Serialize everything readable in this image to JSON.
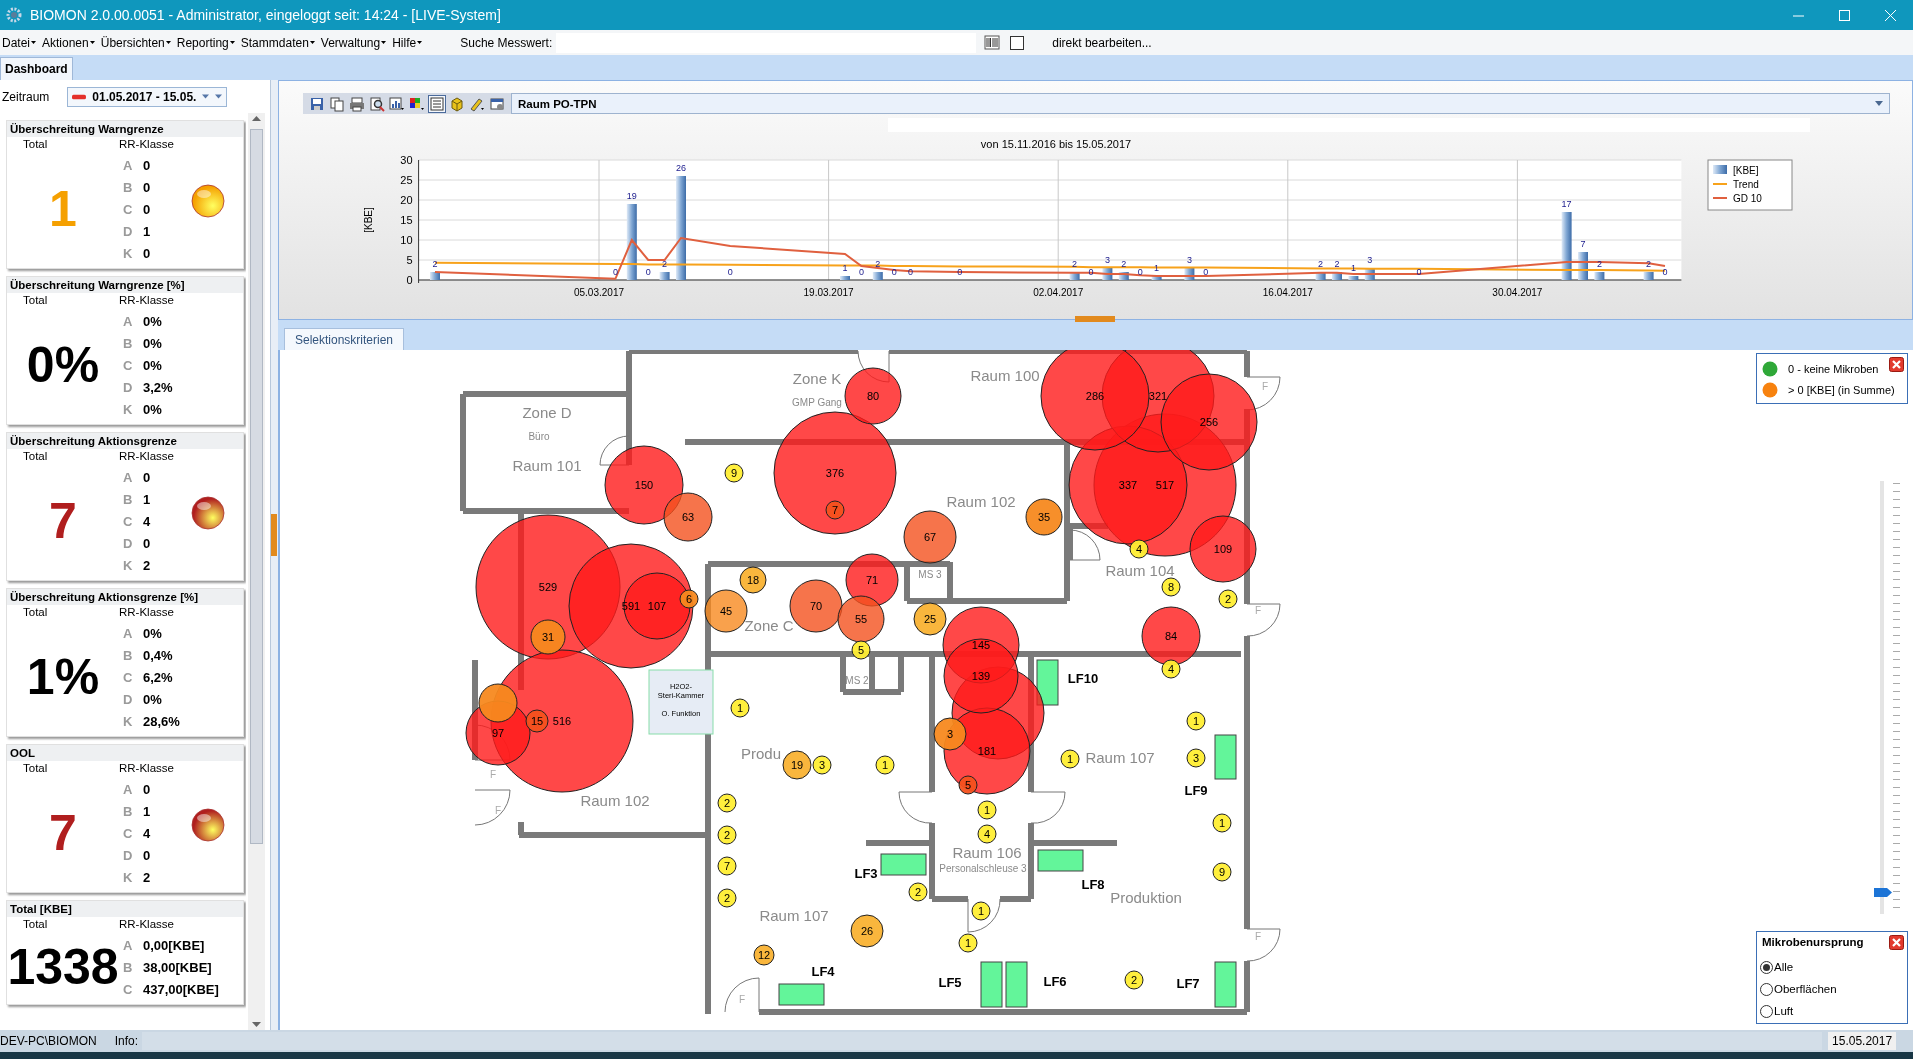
{
  "window": {
    "title": "BIOMON 2.0.00.0051 - Administrator, eingeloggt seit: 14:24 - [LIVE-System]"
  },
  "menu": [
    "Datei",
    "Aktionen",
    "Übersichten",
    "Reporting",
    "Stammdaten",
    "Verwaltung",
    "Hilfe"
  ],
  "search": {
    "label": "Suche Messwert:"
  },
  "direct_edit": {
    "label": "direkt bearbeiten...",
    "checked": false
  },
  "tabs": [
    {
      "label": "Dashboard",
      "selected": true
    }
  ],
  "period": {
    "label": "Zeitraum",
    "value": "01.05.2017 - 15.05."
  },
  "cards": [
    {
      "title": "Überschreitung Warngrenze",
      "total_label": "Total",
      "class_label": "RR-Klasse",
      "total": "1",
      "color": "#f5a000",
      "alert": true,
      "rows": [
        {
          "class": "A",
          "value": "0"
        },
        {
          "class": "B",
          "value": "0"
        },
        {
          "class": "C",
          "value": "0"
        },
        {
          "class": "D",
          "value": "1"
        },
        {
          "class": "K",
          "value": "0"
        }
      ]
    },
    {
      "title": "Überschreitung Warngrenze [%]",
      "total_label": "Total",
      "class_label": "RR-Klasse",
      "total": "0%",
      "color": "#000000",
      "alert": false,
      "rows": [
        {
          "class": "A",
          "value": "0%"
        },
        {
          "class": "B",
          "value": "0%"
        },
        {
          "class": "C",
          "value": "0%"
        },
        {
          "class": "D",
          "value": "3,2%"
        },
        {
          "class": "K",
          "value": "0%"
        }
      ]
    },
    {
      "title": "Überschreitung Aktionsgrenze",
      "total_label": "Total",
      "class_label": "RR-Klasse",
      "total": "7",
      "color": "#b01e1e",
      "alert": true,
      "rows": [
        {
          "class": "A",
          "value": "0"
        },
        {
          "class": "B",
          "value": "1"
        },
        {
          "class": "C",
          "value": "4"
        },
        {
          "class": "D",
          "value": "0"
        },
        {
          "class": "K",
          "value": "2"
        }
      ]
    },
    {
      "title": "Überschreitung Aktionsgrenze [%]",
      "total_label": "Total",
      "class_label": "RR-Klasse",
      "total": "1%",
      "color": "#000000",
      "alert": false,
      "rows": [
        {
          "class": "A",
          "value": "0%"
        },
        {
          "class": "B",
          "value": "0,4%"
        },
        {
          "class": "C",
          "value": "6,2%"
        },
        {
          "class": "D",
          "value": "0%"
        },
        {
          "class": "K",
          "value": "28,6%"
        }
      ]
    },
    {
      "title": "OOL",
      "total_label": "Total",
      "class_label": "RR-Klasse",
      "total": "7",
      "color": "#b01e1e",
      "alert": true,
      "rows": [
        {
          "class": "A",
          "value": "0"
        },
        {
          "class": "B",
          "value": "1"
        },
        {
          "class": "C",
          "value": "4"
        },
        {
          "class": "D",
          "value": "0"
        },
        {
          "class": "K",
          "value": "2"
        }
      ]
    },
    {
      "title": "Total [KBE]",
      "total_label": "Total",
      "class_label": "RR-Klasse",
      "total": "1338",
      "color": "#000000",
      "alert": false,
      "rows": [
        {
          "class": "A",
          "value": "0,00[KBE]"
        },
        {
          "class": "B",
          "value": "38,00[KBE]"
        },
        {
          "class": "C",
          "value": "437,00[KBE]"
        }
      ]
    }
  ],
  "chart_panel": {
    "room": "Raum PO-TPN",
    "chart_data": {
      "type": "bar",
      "title": "von 15.11.2016 bis 15.05.2017",
      "ylabel": "[KBE]",
      "value_labels": [
        null,
        "2",
        null,
        null,
        null,
        null,
        null,
        null,
        null,
        null,
        null,
        null,
        "0",
        "19",
        "0",
        "2",
        "26",
        null,
        null,
        "0",
        null,
        null,
        null,
        null,
        null,
        null,
        "1",
        "0",
        "2",
        "0",
        "0",
        null,
        null,
        "0",
        null,
        null,
        null,
        null,
        null,
        null,
        "2",
        "0",
        "3",
        "2",
        "0",
        "1",
        null,
        "3",
        "0",
        null,
        null,
        null,
        null,
        null,
        null,
        "2",
        "2",
        "1",
        "3",
        null,
        null,
        "0",
        null,
        null,
        null,
        null,
        null,
        null,
        null,
        null,
        "17",
        "7",
        "2",
        null,
        null,
        "2",
        "0",
        null
      ],
      "grid": true,
      "legend": "right",
      "categories": [
        null,
        null,
        null,
        null,
        null,
        null,
        null,
        null,
        null,
        null,
        null,
        "05.03.2017",
        null,
        null,
        null,
        null,
        null,
        null,
        null,
        null,
        null,
        null,
        null,
        null,
        null,
        "19.03.2017",
        null,
        null,
        null,
        null,
        null,
        null,
        null,
        null,
        null,
        null,
        null,
        null,
        null,
        "02.04.2017",
        null,
        null,
        null,
        null,
        null,
        null,
        null,
        null,
        null,
        null,
        null,
        null,
        null,
        "16.04.2017",
        null,
        null,
        null,
        null,
        null,
        null,
        null,
        null,
        null,
        null,
        null,
        null,
        null,
        "30.04.2017",
        null,
        null,
        null,
        null,
        null,
        null,
        null,
        null,
        null,
        null
      ],
      "ylim": [
        0,
        30
      ],
      "yticks": [
        0,
        5,
        10,
        15,
        20,
        25,
        30
      ],
      "series": [
        {
          "name": "[KBE]",
          "color": "#7fa6d3",
          "values": [
            null,
            2,
            null,
            null,
            null,
            null,
            null,
            null,
            null,
            null,
            null,
            null,
            0,
            19,
            0,
            2,
            26,
            null,
            null,
            0,
            null,
            null,
            null,
            null,
            null,
            null,
            1,
            0,
            2,
            0,
            0,
            null,
            null,
            0,
            null,
            null,
            null,
            null,
            null,
            null,
            2,
            0,
            3,
            2,
            0,
            1,
            null,
            3,
            0,
            null,
            null,
            null,
            null,
            null,
            null,
            2,
            2,
            1,
            3,
            null,
            null,
            0,
            null,
            null,
            null,
            null,
            null,
            null,
            null,
            null,
            17,
            7,
            2,
            null,
            null,
            2,
            0,
            null
          ]
        },
        {
          "name": "Trend",
          "type": "line",
          "color": "#f7a21b",
          "values": [
            null,
            4.3,
            null,
            null,
            null,
            null,
            null,
            null,
            null,
            null,
            null,
            null,
            4.0,
            4.0,
            3.9,
            3.9,
            3.9,
            null,
            null,
            3.8,
            null,
            null,
            null,
            null,
            null,
            null,
            3.6,
            3.6,
            3.6,
            3.5,
            3.5,
            null,
            null,
            3.4,
            null,
            null,
            null,
            null,
            null,
            null,
            3.3,
            3.2,
            3.2,
            3.2,
            3.2,
            3.1,
            null,
            3.1,
            3.1,
            null,
            null,
            null,
            null,
            null,
            null,
            2.9,
            2.9,
            2.9,
            2.8,
            null,
            null,
            2.8,
            null,
            null,
            null,
            null,
            null,
            null,
            null,
            null,
            2.5,
            2.5,
            2.5,
            null,
            null,
            2.4,
            2.3,
            null
          ]
        },
        {
          "name": "GD 10",
          "type": "line",
          "color": "#e0603f",
          "values": [
            null,
            2,
            null,
            null,
            null,
            null,
            null,
            null,
            null,
            null,
            null,
            null,
            0.3,
            10,
            5,
            5,
            10.5,
            null,
            null,
            8.5,
            null,
            null,
            null,
            null,
            null,
            null,
            6.5,
            3.5,
            3,
            2.5,
            2.2,
            null,
            null,
            2,
            null,
            null,
            null,
            null,
            null,
            null,
            1.8,
            1.8,
            1.5,
            1.5,
            1.2,
            1,
            null,
            1,
            1,
            null,
            null,
            null,
            null,
            null,
            null,
            1.8,
            1.8,
            1.5,
            1.5,
            null,
            null,
            1.5,
            null,
            null,
            null,
            null,
            null,
            null,
            null,
            null,
            4.5,
            4.5,
            4.5,
            null,
            null,
            4.2,
            3.5,
            null
          ]
        }
      ]
    }
  },
  "map_tabs": [
    {
      "label": "Selektionskriterien",
      "selected": true
    }
  ],
  "floor_plan": {
    "room_labels": [
      {
        "label": "Zone K",
        "kind": "large"
      },
      {
        "label": "GMP Gang",
        "kind": "small"
      },
      {
        "label": "Raum 100",
        "kind": "large"
      },
      {
        "label": "Zone D",
        "kind": "large"
      },
      {
        "label": "Büro",
        "kind": "small"
      },
      {
        "label": "Raum 101",
        "kind": "large"
      },
      {
        "label": "Raum 102",
        "kind": "large"
      },
      {
        "label": "Raum 104",
        "kind": "large"
      },
      {
        "label": "Zone C",
        "kind": "large"
      },
      {
        "label": "MS 3",
        "kind": "small"
      },
      {
        "label": "MS 2",
        "kind": "small"
      },
      {
        "label": "Produ",
        "kind": "large"
      },
      {
        "label": "Raum 102",
        "kind": "large"
      },
      {
        "label": "Raum 107",
        "kind": "large"
      },
      {
        "label": "Raum 106",
        "kind": "large"
      },
      {
        "label": "Personalschleuse 3",
        "kind": "small"
      },
      {
        "label": "Produktion",
        "kind": "large"
      },
      {
        "label": "Raum 107",
        "kind": "large"
      }
    ],
    "door_labels": [
      "F",
      "F",
      "F",
      "F",
      "F",
      "F"
    ],
    "benches": [
      {
        "label": "LF10"
      },
      {
        "label": "LF9"
      },
      {
        "label": "LF3"
      },
      {
        "label": "LF8"
      },
      {
        "label": "LF4"
      },
      {
        "label": "LF5"
      },
      {
        "label": "LF6"
      },
      {
        "label": "LF7"
      }
    ],
    "equipment": {
      "lines": [
        "H2O2-",
        "Steri-Kammer",
        "O. Funktion"
      ]
    },
    "markers": [
      {
        "label": "80",
        "kind": "high"
      },
      {
        "label": "286",
        "kind": "high"
      },
      {
        "label": "321",
        "kind": "high"
      },
      {
        "label": "256",
        "kind": "high"
      },
      {
        "label": "9",
        "kind": "low"
      },
      {
        "label": "376",
        "kind": "high"
      },
      {
        "label": "150",
        "kind": "high"
      },
      {
        "label": "337",
        "kind": "high"
      },
      {
        "label": "517",
        "kind": "high"
      },
      {
        "label": "63",
        "kind": "elevated"
      },
      {
        "label": "7",
        "kind": "elevated"
      },
      {
        "label": "35",
        "kind": "medium"
      },
      {
        "label": "67",
        "kind": "elevated"
      },
      {
        "label": "4",
        "kind": "low"
      },
      {
        "label": "109",
        "kind": "high"
      },
      {
        "label": "529",
        "kind": "high"
      },
      {
        "label": "6",
        "kind": "medium"
      },
      {
        "label": "18",
        "kind": "moderate"
      },
      {
        "label": "71",
        "kind": "high"
      },
      {
        "label": "8",
        "kind": "low"
      },
      {
        "label": "2",
        "kind": "low"
      },
      {
        "label": "591",
        "kind": "high"
      },
      {
        "label": "107",
        "kind": "high"
      },
      {
        "label": "45",
        "kind": "medium"
      },
      {
        "label": "70",
        "kind": "elevated"
      },
      {
        "label": "55",
        "kind": "elevated"
      },
      {
        "label": "25",
        "kind": "moderate"
      },
      {
        "label": "31",
        "kind": "medium"
      },
      {
        "label": "145",
        "kind": "high"
      },
      {
        "label": "84",
        "kind": "high"
      },
      {
        "label": "5",
        "kind": "low"
      },
      {
        "label": "4",
        "kind": "low"
      },
      {
        "label": "139",
        "kind": "high"
      },
      {
        "kind": "medium"
      },
      {
        "label": "15",
        "kind": "elevated"
      },
      {
        "label": "516",
        "kind": "high"
      },
      {
        "label": "1",
        "kind": "low"
      },
      {
        "kind": "high"
      },
      {
        "label": "1",
        "kind": "low"
      },
      {
        "label": "97",
        "kind": "high"
      },
      {
        "label": "3",
        "kind": "medium"
      },
      {
        "label": "19",
        "kind": "moderate"
      },
      {
        "label": "3",
        "kind": "low"
      },
      {
        "label": "1",
        "kind": "low"
      },
      {
        "label": "181",
        "kind": "high"
      },
      {
        "label": "1",
        "kind": "low"
      },
      {
        "label": "3",
        "kind": "low"
      },
      {
        "label": "5",
        "kind": "elevated"
      },
      {
        "label": "2",
        "kind": "low"
      },
      {
        "label": "1",
        "kind": "low"
      },
      {
        "label": "1",
        "kind": "low"
      },
      {
        "label": "2",
        "kind": "low"
      },
      {
        "label": "4",
        "kind": "low"
      },
      {
        "label": "7",
        "kind": "low"
      },
      {
        "label": "9",
        "kind": "low"
      },
      {
        "label": "2",
        "kind": "low"
      },
      {
        "label": "2",
        "kind": "low"
      },
      {
        "label": "1",
        "kind": "low"
      },
      {
        "label": "26",
        "kind": "moderate"
      },
      {
        "label": "1",
        "kind": "low"
      },
      {
        "label": "12",
        "kind": "moderate"
      },
      {
        "label": "2",
        "kind": "low"
      }
    ]
  },
  "legend": {
    "items": [
      {
        "label": "0 - keine Mikroben",
        "color": "#2fa838"
      },
      {
        "label": "> 0 [KBE] (in Summe)",
        "color": "#f7820f"
      }
    ]
  },
  "zoom_slider": {
    "level": 0.05
  },
  "origin_panel": {
    "title": "Mikrobenursprung",
    "options": [
      {
        "label": "Alle",
        "selected": true
      },
      {
        "label": "Oberflächen",
        "selected": false
      },
      {
        "label": "Luft",
        "selected": false
      }
    ]
  },
  "status_bar": {
    "user": "DEV-PC\\BIOMON",
    "info_label": "Info:",
    "date": "15.05.2017"
  }
}
